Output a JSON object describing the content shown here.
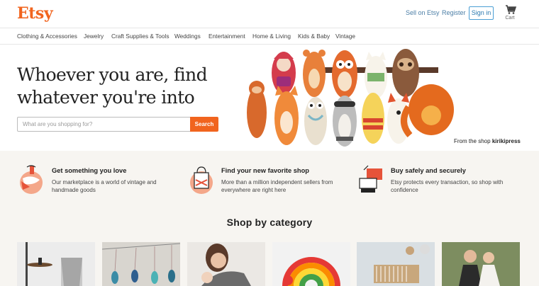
{
  "header": {
    "logo": "Etsy",
    "sell_label": "Sell on Etsy",
    "register_label": "Register",
    "signin_label": "Sign in",
    "cart_label": "Cart"
  },
  "categories": [
    "Clothing & Accessories",
    "Jewelry",
    "Craft Supplies & Tools",
    "Weddings",
    "Entertainment",
    "Home & Living",
    "Kids & Baby",
    "Vintage"
  ],
  "hero": {
    "headline_line1": "Whoever you are, find",
    "headline_line2": "whatever you're into",
    "search_placeholder": "What are you shopping for?",
    "search_button": "Search",
    "credit_prefix": "From the shop",
    "credit_shop": "kirikipress"
  },
  "value_props": [
    {
      "title": "Get something you love",
      "body": "Our marketplace is a world of vintage and handmade goods",
      "icon": "scarf-gift-icon"
    },
    {
      "title": "Find your new favorite shop",
      "body": "More than a million independent sellers from everywhere are right here",
      "icon": "shop-bag-icon"
    },
    {
      "title": "Buy safely and securely",
      "body": "Etsy protects every transaction, so shop with confidence",
      "icon": "secure-payment-icon"
    }
  ],
  "shop_by_category": {
    "title": "Shop by category"
  },
  "colors": {
    "brand": "#f1641e",
    "link": "#4b7ea6",
    "band": "#f7f5f1"
  }
}
